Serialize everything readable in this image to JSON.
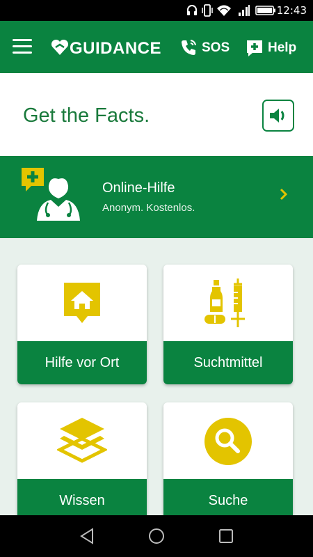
{
  "status_bar": {
    "time": "12:43"
  },
  "app_bar": {
    "brand": "GUIDANCE",
    "sos_label": "SOS",
    "help_label": "Help"
  },
  "facts": {
    "title": "Get the Facts."
  },
  "online_help": {
    "title": "Online-Hilfe",
    "subtitle": "Anonym. Kostenlos."
  },
  "cards": [
    {
      "label": "Hilfe vor Ort",
      "icon": "home-marker-icon"
    },
    {
      "label": "Suchtmittel",
      "icon": "bottle-syringe-pill-icon"
    },
    {
      "label": "Wissen",
      "icon": "layers-icon"
    },
    {
      "label": "Suche",
      "icon": "search-icon"
    }
  ],
  "colors": {
    "brand_green": "#0a8340",
    "accent_yellow": "#e3c400",
    "background": "#e8f1ec"
  }
}
